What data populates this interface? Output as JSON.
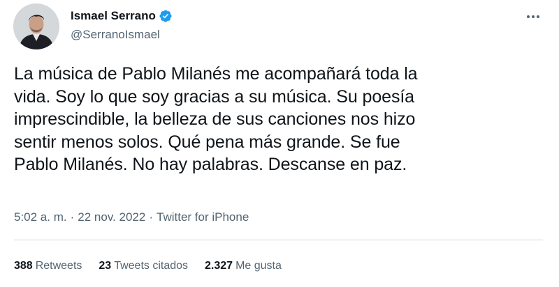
{
  "author": {
    "display_name": "Ismael Serrano",
    "handle": "@SerranoIsmael",
    "verified": true,
    "avatar_icon": "person-avatar"
  },
  "more_icon": "more-dots-icon",
  "tweet": {
    "lines": [
      "La música de Pablo Milanés me acompañará toda la",
      "vida. Soy lo que soy gracias a su música. Su poesía",
      "imprescindible, la belleza de sus canciones nos hizo",
      "sentir menos solos. Qué pena más grande. Se fue",
      "Pablo Milanés. No hay palabras. Descanse en paz."
    ]
  },
  "meta": {
    "time": "5:02 a. m.",
    "separator": "·",
    "date": "22 nov. 2022",
    "source": "Twitter for iPhone"
  },
  "stats": {
    "retweets": {
      "count": "388",
      "label": "Retweets"
    },
    "quotes": {
      "count": "23",
      "label": "Tweets citados"
    },
    "likes": {
      "count": "2.327",
      "label": "Me gusta"
    }
  },
  "colors": {
    "text": "#0f1419",
    "secondary": "#536471",
    "verified": "#1d9bf0",
    "divider": "#cfd9de"
  }
}
